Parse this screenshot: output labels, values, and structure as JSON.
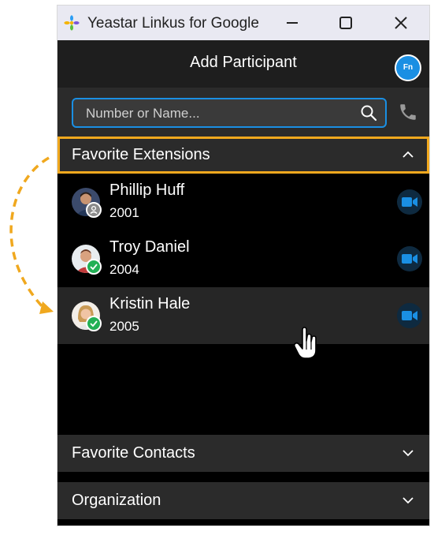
{
  "window": {
    "title": "Yeastar Linkus for Google"
  },
  "header": {
    "title": "Add Participant",
    "avatar_initials": "Fn",
    "avatar_color": "#1a8fe3"
  },
  "search": {
    "placeholder": "Number or Name..."
  },
  "sections": {
    "favorite_extensions": {
      "label": "Favorite Extensions",
      "expanded": true
    },
    "favorite_contacts": {
      "label": "Favorite Contacts",
      "expanded": false
    },
    "organization": {
      "label": "Organization",
      "expanded": false
    }
  },
  "contacts": [
    {
      "name": "Phillip Huff",
      "extension": "2001",
      "status": "offline"
    },
    {
      "name": "Troy Daniel",
      "extension": "2004",
      "status": "online"
    },
    {
      "name": "Kristin Hale",
      "extension": "2005",
      "status": "online"
    }
  ],
  "colors": {
    "highlight": "#f0a81e",
    "accent": "#1a8fe3",
    "online": "#22b055"
  }
}
